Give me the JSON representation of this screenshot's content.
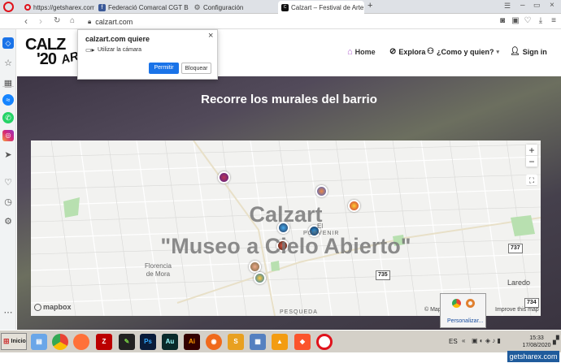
{
  "browser": {
    "tabs": [
      {
        "label": "https://getsharex.com/chang",
        "icon": "opera-icon"
      },
      {
        "label": "Federació Comarcal CGT Ba",
        "icon": "facebook-icon"
      },
      {
        "label": "Configuración",
        "icon": "gear-icon"
      },
      {
        "label": "Calzart – Festival de Arte Urb",
        "icon": "calzart-icon"
      }
    ],
    "new_tab": "+",
    "url": "calzart.com"
  },
  "permission": {
    "title": "calzart.com quiere",
    "item": "Utilizar la cámara",
    "allow": "Permitir",
    "block": "Bloquear",
    "close": "×"
  },
  "site": {
    "logo_top": "CALZ",
    "logo_year": "'20",
    "logo_script": "ART",
    "nav": {
      "home": "Home",
      "explore": "Explora",
      "about": "¿Como y quien?",
      "signin": "Sign in"
    },
    "hero_title": "Recorre los murales del barrio"
  },
  "map": {
    "overlay_1": "Calzart",
    "overlay_2": "\"Museo a Cielo Abierto\"",
    "zoom_in": "+",
    "zoom_out": "−",
    "fullscreen": "⛶",
    "places": {
      "florencia": "Florencia\nde Mora",
      "porvenir_1": "El",
      "porvenir_2": "PORVENIR",
      "laredo": "Laredo",
      "pesqueda": "PESQUEDA"
    },
    "roads": [
      "737",
      "735",
      "734"
    ],
    "logo": "mapbox",
    "attribution_1": "© Map",
    "attribution_2": "Improve this map"
  },
  "tray_popup": {
    "label": "Personalizar..."
  },
  "taskbar": {
    "start": "Inicio",
    "lang": "ES",
    "time": "15:33",
    "date": "17/08/2020"
  },
  "watermark": "getsharex.com"
}
